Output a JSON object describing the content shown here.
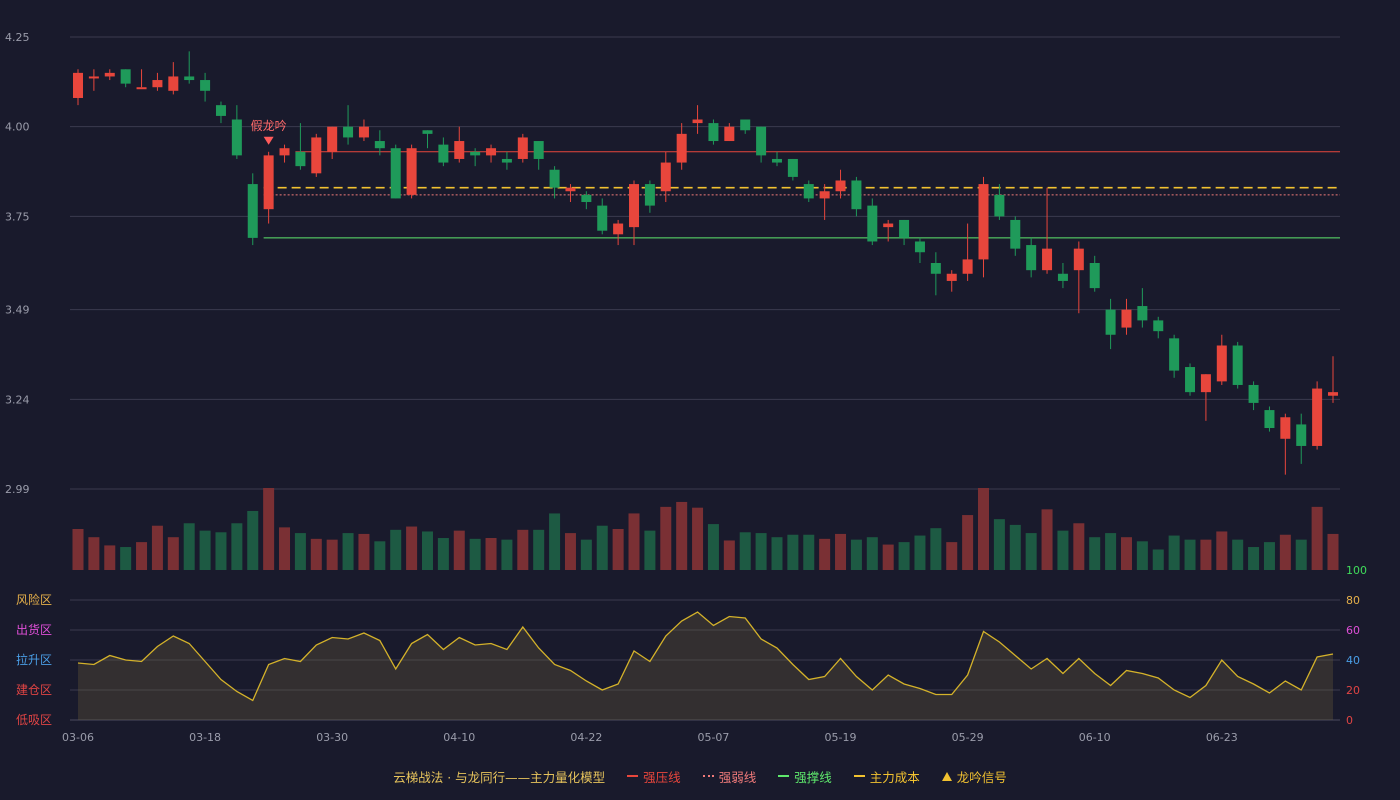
{
  "colors": {
    "background": "#191a2c",
    "up": "#e8463c",
    "down": "#1f9a5a",
    "grid": "#3a3b4e",
    "axis_text": "#9a9caa",
    "pressure_line": "#e8463c",
    "weak_line": "#f07a7a",
    "support_line": "#5ee86c",
    "cost_line": "#f2c230",
    "oscillator": "#d4b22a"
  },
  "legend": {
    "title": "云梯战法 · 与龙同行——主力量化模型",
    "items": [
      {
        "label": "强压线",
        "style": "solid",
        "color": "#e8463c"
      },
      {
        "label": "强弱线",
        "style": "dotted",
        "color": "#f07a7a"
      },
      {
        "label": "强撑线",
        "style": "solid",
        "color": "#5ee86c"
      },
      {
        "label": "主力成本",
        "style": "dashed",
        "color": "#f2c230"
      },
      {
        "label": "龙吟信号",
        "style": "triangle",
        "color": "#f2c230"
      }
    ]
  },
  "chart_data": [
    {
      "type": "candlestick",
      "x_tick_labels": [
        "03-06",
        "03-18",
        "03-30",
        "04-10",
        "04-22",
        "05-07",
        "05-19",
        "05-29",
        "06-10",
        "06-23"
      ],
      "x_tick_indices": [
        0,
        8,
        16,
        24,
        32,
        40,
        48,
        56,
        64,
        72
      ],
      "y_tick_labels": [
        "4.25",
        "4.00",
        "3.75",
        "3.49",
        "3.24",
        "2.99"
      ],
      "y_ticks": [
        4.25,
        4.0,
        3.75,
        3.49,
        3.24,
        2.99
      ],
      "ylim": [
        2.99,
        4.25
      ],
      "grid": true,
      "candles": [
        [
          4.08,
          4.15,
          4.16,
          4.06
        ],
        [
          4.14,
          4.14,
          4.16,
          4.1
        ],
        [
          4.14,
          4.15,
          4.16,
          4.13
        ],
        [
          4.16,
          4.12,
          4.16,
          4.11
        ],
        [
          4.11,
          4.11,
          4.16,
          4.11
        ],
        [
          4.11,
          4.13,
          4.15,
          4.1
        ],
        [
          4.1,
          4.14,
          4.18,
          4.09
        ],
        [
          4.14,
          4.13,
          4.21,
          4.12
        ],
        [
          4.13,
          4.1,
          4.15,
          4.07
        ],
        [
          4.06,
          4.03,
          4.07,
          4.01
        ],
        [
          4.02,
          3.92,
          4.06,
          3.91
        ],
        [
          3.84,
          3.69,
          3.87,
          3.67
        ],
        [
          3.77,
          3.92,
          3.93,
          3.73
        ],
        [
          3.92,
          3.94,
          3.95,
          3.9
        ],
        [
          3.93,
          3.89,
          4.01,
          3.88
        ],
        [
          3.87,
          3.97,
          3.98,
          3.86
        ],
        [
          3.93,
          4.0,
          4.0,
          3.91
        ],
        [
          4.0,
          3.97,
          4.06,
          3.95
        ],
        [
          3.97,
          4.0,
          4.02,
          3.96
        ],
        [
          3.96,
          3.94,
          3.99,
          3.92
        ],
        [
          3.94,
          3.8,
          3.95,
          3.8
        ],
        [
          3.81,
          3.94,
          3.95,
          3.8
        ],
        [
          3.99,
          3.98,
          3.99,
          3.94
        ],
        [
          3.95,
          3.9,
          3.97,
          3.89
        ],
        [
          3.91,
          3.96,
          4.0,
          3.9
        ],
        [
          3.93,
          3.92,
          3.94,
          3.89
        ],
        [
          3.92,
          3.94,
          3.95,
          3.9
        ],
        [
          3.91,
          3.9,
          3.93,
          3.88
        ],
        [
          3.91,
          3.97,
          3.98,
          3.9
        ],
        [
          3.96,
          3.91,
          3.96,
          3.88
        ],
        [
          3.88,
          3.83,
          3.89,
          3.8
        ],
        [
          3.82,
          3.83,
          3.84,
          3.79
        ],
        [
          3.81,
          3.79,
          3.82,
          3.77
        ],
        [
          3.78,
          3.71,
          3.8,
          3.7
        ],
        [
          3.7,
          3.73,
          3.74,
          3.67
        ],
        [
          3.72,
          3.84,
          3.85,
          3.67
        ],
        [
          3.84,
          3.78,
          3.85,
          3.76
        ],
        [
          3.82,
          3.9,
          3.93,
          3.79
        ],
        [
          3.9,
          3.98,
          4.01,
          3.88
        ],
        [
          4.01,
          4.02,
          4.06,
          3.98
        ],
        [
          4.01,
          3.96,
          4.02,
          3.95
        ],
        [
          3.96,
          4.0,
          4.01,
          3.96
        ],
        [
          4.02,
          3.99,
          4.02,
          3.98
        ],
        [
          4.0,
          3.92,
          4.0,
          3.9
        ],
        [
          3.91,
          3.9,
          3.93,
          3.89
        ],
        [
          3.91,
          3.86,
          3.91,
          3.85
        ],
        [
          3.84,
          3.8,
          3.85,
          3.79
        ],
        [
          3.8,
          3.82,
          3.84,
          3.74
        ],
        [
          3.82,
          3.85,
          3.88,
          3.8
        ],
        [
          3.85,
          3.77,
          3.86,
          3.75
        ],
        [
          3.78,
          3.68,
          3.8,
          3.67
        ],
        [
          3.72,
          3.73,
          3.74,
          3.68
        ],
        [
          3.74,
          3.69,
          3.74,
          3.67
        ],
        [
          3.68,
          3.65,
          3.69,
          3.62
        ],
        [
          3.62,
          3.59,
          3.65,
          3.53
        ],
        [
          3.57,
          3.59,
          3.6,
          3.54
        ],
        [
          3.59,
          3.63,
          3.73,
          3.57
        ],
        [
          3.63,
          3.84,
          3.86,
          3.58
        ],
        [
          3.81,
          3.75,
          3.84,
          3.74
        ],
        [
          3.74,
          3.66,
          3.75,
          3.64
        ],
        [
          3.67,
          3.6,
          3.69,
          3.58
        ],
        [
          3.6,
          3.66,
          3.83,
          3.59
        ],
        [
          3.59,
          3.57,
          3.62,
          3.55
        ],
        [
          3.6,
          3.66,
          3.68,
          3.48
        ],
        [
          3.62,
          3.55,
          3.64,
          3.54
        ],
        [
          3.49,
          3.42,
          3.52,
          3.38
        ],
        [
          3.44,
          3.49,
          3.52,
          3.42
        ],
        [
          3.5,
          3.46,
          3.55,
          3.44
        ],
        [
          3.46,
          3.43,
          3.47,
          3.41
        ],
        [
          3.41,
          3.32,
          3.42,
          3.3
        ],
        [
          3.33,
          3.26,
          3.34,
          3.25
        ],
        [
          3.26,
          3.31,
          3.31,
          3.18
        ],
        [
          3.29,
          3.39,
          3.42,
          3.28
        ],
        [
          3.39,
          3.28,
          3.4,
          3.27
        ],
        [
          3.28,
          3.23,
          3.29,
          3.21
        ],
        [
          3.21,
          3.16,
          3.22,
          3.15
        ],
        [
          3.13,
          3.19,
          3.2,
          3.03
        ],
        [
          3.17,
          3.11,
          3.2,
          3.06
        ],
        [
          3.11,
          3.27,
          3.29,
          3.1
        ],
        [
          3.25,
          3.26,
          3.36,
          3.23
        ]
      ],
      "horizontal_lines": [
        {
          "name": "强压线",
          "value": 3.93,
          "style": "solid",
          "start_index": 14
        },
        {
          "name": "主力成本",
          "value": 3.83,
          "style": "dashed",
          "start_index": 12
        },
        {
          "name": "强弱线",
          "value": 3.81,
          "style": "dotted",
          "start_index": 12
        },
        {
          "name": "强撑线",
          "value": 3.69,
          "style": "solid",
          "start_index": 12
        }
      ],
      "annotations": [
        {
          "text": "假龙吟",
          "index": 12
        }
      ]
    },
    {
      "type": "bar",
      "name": "volume",
      "values": [
        50,
        40,
        30,
        28,
        34,
        54,
        40,
        57,
        48,
        46,
        57,
        72,
        100,
        52,
        45,
        38,
        37,
        45,
        44,
        35,
        49,
        53,
        47,
        39,
        48,
        38,
        39,
        37,
        49,
        49,
        69,
        45,
        37,
        54,
        50,
        69,
        48,
        77,
        83,
        76,
        56,
        36,
        46,
        45,
        40,
        43,
        43,
        38,
        44,
        37,
        40,
        31,
        34,
        42,
        51,
        34,
        67,
        100,
        62,
        55,
        45,
        74,
        48,
        57,
        40,
        45,
        40,
        35,
        25,
        42,
        37,
        37,
        47,
        37,
        28,
        34,
        43,
        37,
        77,
        44
      ]
    },
    {
      "type": "line",
      "name": "oscillator",
      "ylim": [
        0,
        100
      ],
      "y_ticks": [
        0,
        20,
        40,
        60,
        80,
        100
      ],
      "y_tick_labels": [
        "0",
        "20",
        "40",
        "60",
        "80",
        "100"
      ],
      "zones": [
        {
          "label": "风险区",
          "color": "#e6b04a"
        },
        {
          "label": "出货区",
          "color": "#e04fd8"
        },
        {
          "label": "拉升区",
          "color": "#4a9ee6"
        },
        {
          "label": "建仓区",
          "color": "#e04444"
        },
        {
          "label": "低吸区",
          "color": "#e04444"
        }
      ],
      "values": [
        38,
        37,
        43,
        40,
        39,
        49,
        56,
        51,
        39,
        27,
        19,
        13,
        37,
        41,
        39,
        50,
        55,
        54,
        58,
        53,
        34,
        51,
        57,
        47,
        55,
        50,
        51,
        47,
        62,
        48,
        37,
        33,
        26,
        20,
        24,
        46,
        39,
        56,
        66,
        72,
        63,
        69,
        68,
        54,
        48,
        37,
        27,
        29,
        41,
        29,
        20,
        30,
        24,
        21,
        17,
        17,
        30,
        59,
        52,
        43,
        34,
        41,
        31,
        41,
        31,
        23,
        33,
        31,
        28,
        20,
        15,
        23,
        40,
        29,
        24,
        18,
        26,
        20,
        42,
        44
      ]
    }
  ]
}
